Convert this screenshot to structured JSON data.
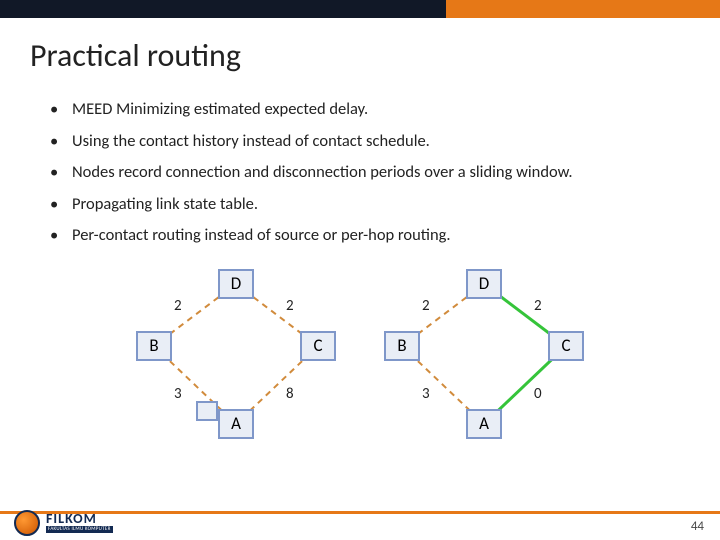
{
  "title": "Practical routing",
  "bullets": [
    "MEED Minimizing estimated expected delay.",
    "Using the contact history instead of contact schedule.",
    "Nodes record connection and disconnection periods over a sliding window.",
    "Propagating link state table.",
    "Per-contact routing instead of source or per-hop routing."
  ],
  "graphs": {
    "left": {
      "nodes": {
        "top": "D",
        "left": "B",
        "right": "C",
        "bottom": "A"
      },
      "edges": {
        "top_left": "2",
        "top_right": "2",
        "bottom_left": "3",
        "bottom_right": "8"
      }
    },
    "right": {
      "nodes": {
        "top": "D",
        "left": "B",
        "right": "C",
        "bottom": "A"
      },
      "edges": {
        "top_left": "2",
        "top_right": "2",
        "bottom_left": "3",
        "bottom_right": "0"
      }
    }
  },
  "logo": {
    "main": "FILKOM",
    "sub": "FAKULTAS ILMU KOMPUTER"
  },
  "page_number": "44",
  "colors": {
    "accent": "#e67817",
    "node_border": "#7f97c9",
    "node_fill": "#e9eef6",
    "highlight_edge": "#35c43a"
  },
  "chart_data": [
    {
      "type": "diagram",
      "title": "Routing graph (left)",
      "nodes": [
        "A",
        "B",
        "C",
        "D"
      ],
      "edges": [
        {
          "from": "B",
          "to": "D",
          "weight": 2,
          "style": "dashed"
        },
        {
          "from": "C",
          "to": "D",
          "weight": 2,
          "style": "dashed"
        },
        {
          "from": "A",
          "to": "B",
          "weight": 3,
          "style": "dashed"
        },
        {
          "from": "A",
          "to": "C",
          "weight": 8,
          "style": "dashed"
        }
      ]
    },
    {
      "type": "diagram",
      "title": "Routing graph (right)",
      "nodes": [
        "A",
        "B",
        "C",
        "D"
      ],
      "edges": [
        {
          "from": "B",
          "to": "D",
          "weight": 2,
          "style": "dashed"
        },
        {
          "from": "C",
          "to": "D",
          "weight": 2,
          "style": "solid-highlight"
        },
        {
          "from": "A",
          "to": "B",
          "weight": 3,
          "style": "dashed"
        },
        {
          "from": "A",
          "to": "C",
          "weight": 0,
          "style": "solid-highlight"
        }
      ]
    }
  ]
}
